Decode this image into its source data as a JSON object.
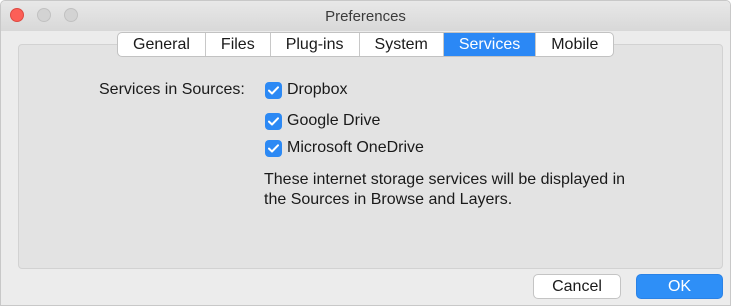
{
  "window": {
    "title": "Preferences"
  },
  "tabs": [
    {
      "label": "General",
      "active": false
    },
    {
      "label": "Files",
      "active": false
    },
    {
      "label": "Plug-ins",
      "active": false
    },
    {
      "label": "System",
      "active": false
    },
    {
      "label": "Services",
      "active": true
    },
    {
      "label": "Mobile",
      "active": false
    }
  ],
  "services": {
    "label": "Services in Sources:",
    "options": [
      {
        "label": "Dropbox",
        "checked": true
      },
      {
        "label": "Google Drive",
        "checked": true
      },
      {
        "label": "Microsoft OneDrive",
        "checked": true
      }
    ],
    "description_line1": "These internet storage services will be displayed in",
    "description_line2": "the Sources in Browse and Layers."
  },
  "buttons": {
    "cancel": "Cancel",
    "ok": "OK"
  },
  "colors": {
    "accent": "#2b88f5",
    "close": "#fc5f57"
  }
}
